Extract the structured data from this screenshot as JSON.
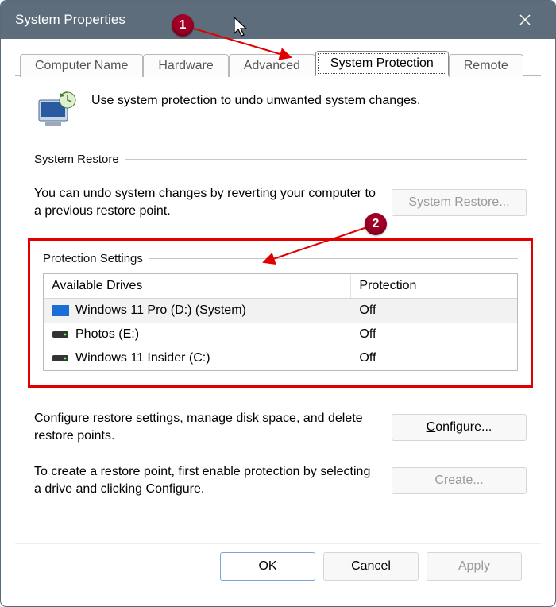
{
  "window": {
    "title": "System Properties"
  },
  "tabs": {
    "computer_name": "Computer Name",
    "hardware": "Hardware",
    "advanced": "Advanced",
    "system_protection": "System Protection",
    "remote": "Remote"
  },
  "intro": {
    "text": "Use system protection to undo unwanted system changes."
  },
  "restore": {
    "group": "System Restore",
    "text": "You can undo system changes by reverting your computer to a previous restore point.",
    "button": "System Restore..."
  },
  "settings": {
    "group": "Protection Settings",
    "col_drive": "Available Drives",
    "col_prot": "Protection",
    "drives": [
      {
        "name": "Windows 11 Pro (D:) (System)",
        "protection": "Off",
        "icon": "system"
      },
      {
        "name": "Photos (E:)",
        "protection": "Off",
        "icon": "hdd"
      },
      {
        "name": "Windows 11 Insider (C:)",
        "protection": "Off",
        "icon": "hdd"
      }
    ]
  },
  "configure": {
    "text": "Configure restore settings, manage disk space, and delete restore points.",
    "prefix": "C",
    "rest": "onfigure..."
  },
  "create": {
    "text": "To create a restore point, first enable protection by selecting a drive and clicking Configure.",
    "prefix": "C",
    "rest": "reate..."
  },
  "buttons": {
    "ok": "OK",
    "cancel": "Cancel",
    "apply": "Apply"
  },
  "annotations": {
    "one": "1",
    "two": "2"
  }
}
